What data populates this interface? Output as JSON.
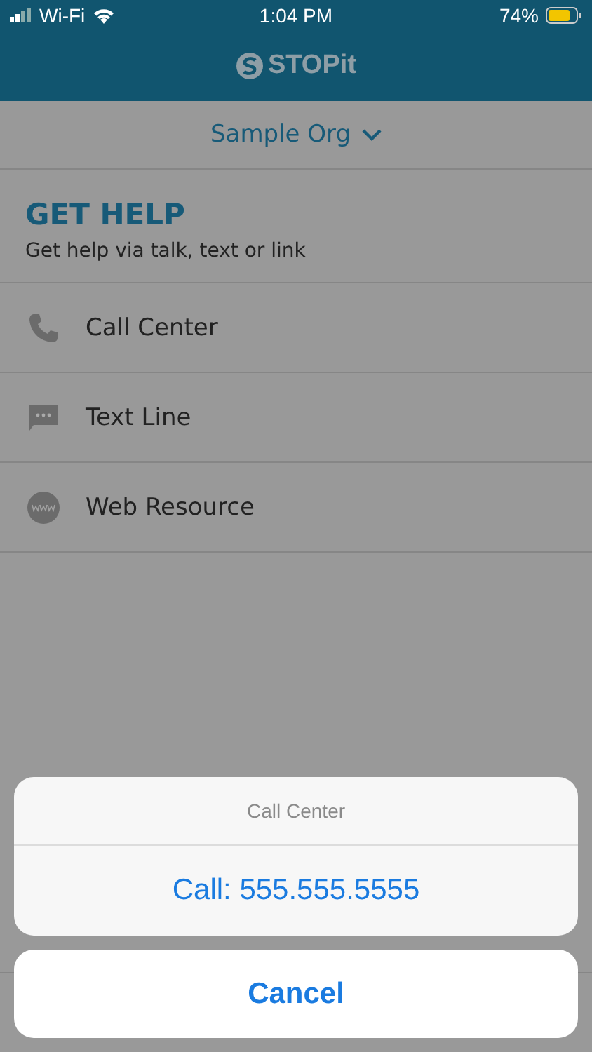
{
  "status_bar": {
    "carrier": "Wi-Fi",
    "time": "1:04 PM",
    "battery": "74%"
  },
  "header": {
    "logo": "STOPit"
  },
  "org_selector": {
    "label": "Sample Org"
  },
  "section": {
    "title": "GET HELP",
    "subtitle": "Get help via talk, text or link"
  },
  "help_options": [
    {
      "kind": "phone",
      "label": "Call Center"
    },
    {
      "kind": "text",
      "label": "Text Line"
    },
    {
      "kind": "web",
      "label": "Web Resource"
    }
  ],
  "action_sheet": {
    "title": "Call Center",
    "actions": [
      "Call: 555.555.5555"
    ],
    "cancel": "Cancel"
  }
}
